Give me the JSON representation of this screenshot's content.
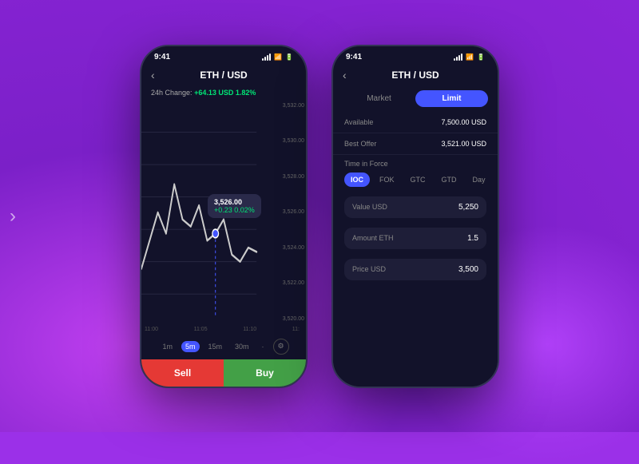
{
  "background": {
    "color": "#9b30e8"
  },
  "phone1": {
    "status": {
      "time": "9:41",
      "signal": true,
      "wifi": true,
      "battery": true
    },
    "header": {
      "back_label": "‹",
      "title": "ETH / USD"
    },
    "change_bar": {
      "label": "24h Change:",
      "value": "+64.13 USD 1.82%"
    },
    "chart": {
      "price_labels": [
        "3,532.00",
        "3,530.00",
        "3,528.00",
        "3,526.00",
        "3,524.00",
        "3,522.00",
        "3,520.00"
      ],
      "tooltip": {
        "price": "3,526.00",
        "change": "+0.23  0.02%"
      },
      "time_labels": [
        "11:00",
        "11:05",
        "11:10",
        "11:"
      ]
    },
    "timeframes": [
      "1m",
      "5m",
      "15m",
      "30m"
    ],
    "active_timeframe": "5m",
    "actions": {
      "sell_label": "Sell",
      "buy_label": "Buy"
    }
  },
  "phone2": {
    "status": {
      "time": "9:41",
      "signal": true,
      "wifi": true,
      "battery": true
    },
    "header": {
      "back_label": "‹",
      "title": "ETH / USD"
    },
    "tabs": [
      {
        "label": "Market",
        "active": false
      },
      {
        "label": "Limit",
        "active": true
      }
    ],
    "info_rows": [
      {
        "label": "Available",
        "value": "7,500.00 USD"
      },
      {
        "label": "Best Offer",
        "value": "3,521.00 USD"
      }
    ],
    "tif": {
      "label": "Time in Force",
      "options": [
        "IOC",
        "FOK",
        "GTC",
        "GTD",
        "Day"
      ],
      "active": "IOC"
    },
    "fields": [
      {
        "label": "Value USD",
        "value": "5,250"
      },
      {
        "label": "Amount ETH",
        "value": "1.5"
      },
      {
        "label": "Price USD",
        "value": "3,500"
      }
    ]
  }
}
